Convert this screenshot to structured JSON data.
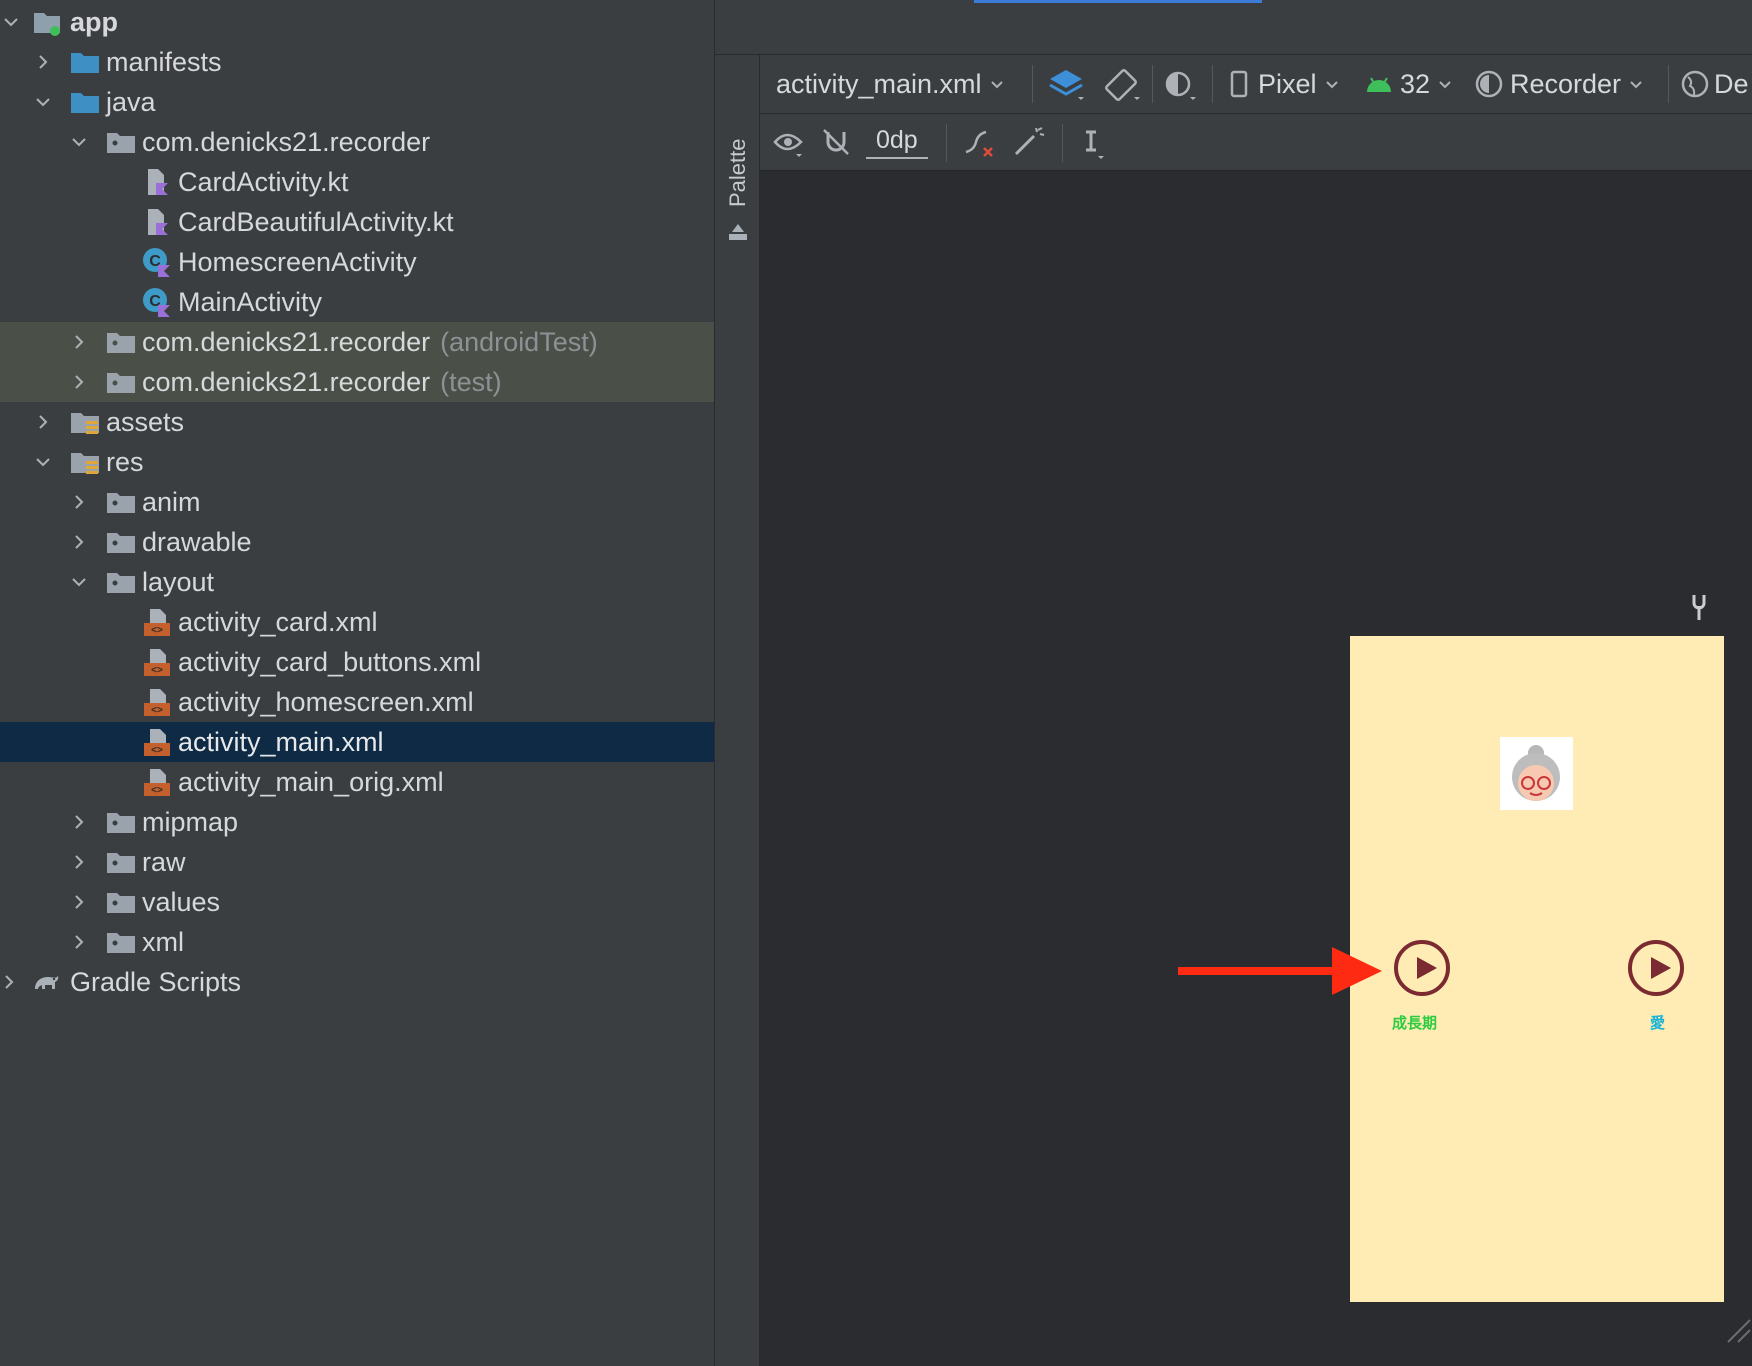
{
  "project_tree": {
    "items": [
      {
        "label": "app",
        "icon": "module-folder-icon"
      },
      {
        "label": "manifests",
        "icon": "folder-icon"
      },
      {
        "label": "java",
        "icon": "folder-icon"
      },
      {
        "label": "com.denicks21.recorder",
        "icon": "package-icon"
      },
      {
        "label": "CardActivity.kt",
        "icon": "kotlin-file-icon"
      },
      {
        "label": "CardBeautifulActivity.kt",
        "icon": "kotlin-file-icon"
      },
      {
        "label": "HomescreenActivity",
        "icon": "kotlin-class-icon"
      },
      {
        "label": "MainActivity",
        "icon": "kotlin-class-icon"
      },
      {
        "label": "com.denicks21.recorder",
        "suffix": "(androidTest)",
        "icon": "package-icon"
      },
      {
        "label": "com.denicks21.recorder",
        "suffix": "(test)",
        "icon": "package-icon"
      },
      {
        "label": "assets",
        "icon": "resource-folder-icon"
      },
      {
        "label": "res",
        "icon": "resource-folder-icon"
      },
      {
        "label": "anim",
        "icon": "folder-icon"
      },
      {
        "label": "drawable",
        "icon": "folder-icon"
      },
      {
        "label": "layout",
        "icon": "folder-icon"
      },
      {
        "label": "activity_card.xml",
        "icon": "layout-file-icon"
      },
      {
        "label": "activity_card_buttons.xml",
        "icon": "layout-file-icon"
      },
      {
        "label": "activity_homescreen.xml",
        "icon": "layout-file-icon"
      },
      {
        "label": "activity_main.xml",
        "icon": "layout-file-icon"
      },
      {
        "label": "activity_main_orig.xml",
        "icon": "layout-file-icon"
      },
      {
        "label": "mipmap",
        "icon": "folder-icon"
      },
      {
        "label": "raw",
        "icon": "folder-icon"
      },
      {
        "label": "values",
        "icon": "folder-icon"
      },
      {
        "label": "xml",
        "icon": "folder-icon"
      },
      {
        "label": "Gradle Scripts",
        "icon": "gradle-icon"
      }
    ]
  },
  "palette": {
    "label": "Palette"
  },
  "toolbar": {
    "file_label": "activity_main.xml",
    "device_label": "Pixel",
    "api_label": "32",
    "theme_label": "Recorder",
    "locale_label": "De",
    "margin_label": "0dp"
  },
  "preview": {
    "button1_label": "成長期",
    "button2_label": "愛",
    "background_color": "#ffecb5",
    "label1_color": "#2ecc40",
    "label2_color": "#1ab3d8",
    "arrow_color": "#ff2a12"
  }
}
